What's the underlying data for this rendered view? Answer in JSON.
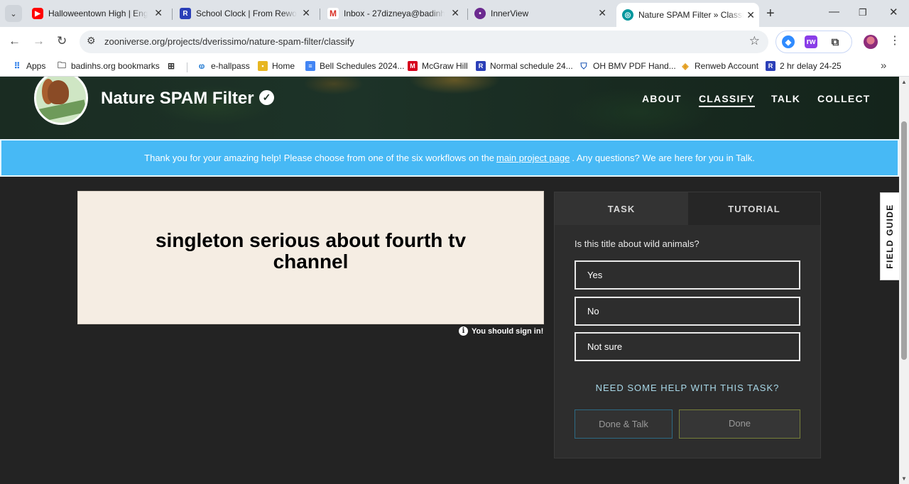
{
  "browser": {
    "tabs": [
      {
        "title": "Halloweentown High | Englis",
        "favicon": "youtube-icon"
      },
      {
        "title": "School Clock | From Reword",
        "favicon": "reword-icon"
      },
      {
        "title": "Inbox - 27dizneya@badinhs.",
        "favicon": "gmail-icon"
      },
      {
        "title": "InnerView",
        "favicon": "innerview-icon"
      },
      {
        "title": "Nature SPAM Filter » Classify",
        "favicon": "zooniverse-icon",
        "active": true
      }
    ],
    "url": "zooniverse.org/projects/dverissimo/nature-spam-filter/classify",
    "bookmarks": [
      {
        "label": "Apps"
      },
      {
        "label": "badinhs.org bookmarks"
      },
      {
        "label": "e-hallpass"
      },
      {
        "label": "Home"
      },
      {
        "label": "Bell Schedules 2024..."
      },
      {
        "label": "McGraw Hill"
      },
      {
        "label": "Normal schedule 24..."
      },
      {
        "label": "OH BMV PDF Hand..."
      },
      {
        "label": "Renweb Account"
      },
      {
        "label": "2 hr delay 24-25"
      }
    ]
  },
  "project": {
    "title": "Nature SPAM Filter",
    "logo_text": "Nature SPAM Filter",
    "nav": [
      {
        "label": "ABOUT"
      },
      {
        "label": "CLASSIFY",
        "active": true
      },
      {
        "label": "TALK"
      },
      {
        "label": "COLLECT"
      }
    ]
  },
  "banner": {
    "text_before": "Thank you for your amazing help! Please choose from one of the six workflows on the",
    "link": "main project page",
    "text_after": ". Any questions? We are here for you in Talk."
  },
  "subject": {
    "text": "singleton serious about fourth tv channel",
    "sign_in_notice": "You should sign in!"
  },
  "task": {
    "tabs": {
      "task": "TASK",
      "tutorial": "TUTORIAL"
    },
    "question": "Is this title about wild animals?",
    "answers": [
      "Yes",
      "No",
      "Not sure"
    ],
    "help": "NEED SOME HELP WITH THIS TASK?",
    "done_talk": "Done & Talk",
    "done": "Done"
  },
  "field_guide": "FIELD GUIDE",
  "colors": {
    "banner": "#47b9f5",
    "panel": "#2d2d2d",
    "page_bg": "#232323",
    "help_link": "#a8d8e8",
    "done_border": "#77803a",
    "done_talk_border": "#2e6b85"
  }
}
